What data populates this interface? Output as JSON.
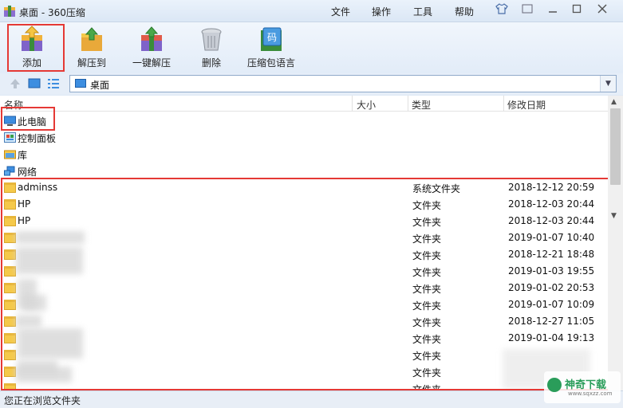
{
  "window": {
    "title": "桌面 - 360压缩"
  },
  "menu": [
    "文件",
    "操作",
    "工具",
    "帮助"
  ],
  "toolbar": {
    "buttons": [
      {
        "label": "添加",
        "icon": "add-archive-icon"
      },
      {
        "label": "解压到",
        "icon": "extract-to-icon"
      },
      {
        "label": "一键解压",
        "icon": "one-click-extract-icon"
      },
      {
        "label": "删除",
        "icon": "trash-icon"
      },
      {
        "label": "压缩包语言",
        "icon": "archive-language-icon",
        "badge": "码"
      }
    ]
  },
  "address": {
    "path": "桌面"
  },
  "columns": {
    "name": "名称",
    "size": "大小",
    "type": "类型",
    "modified": "修改日期"
  },
  "special_items": [
    {
      "name": "此电脑",
      "icon": "computer-icon"
    },
    {
      "name": "控制面板",
      "icon": "control-panel-icon"
    },
    {
      "name": "库",
      "icon": "library-icon"
    },
    {
      "name": "网络",
      "icon": "network-icon"
    }
  ],
  "files": [
    {
      "name": "adminss",
      "type": "系统文件夹",
      "date": "2018-12-12 20:59"
    },
    {
      "name": "HP",
      "type": "文件夹",
      "date": "2018-12-03 20:44"
    },
    {
      "name": "HP",
      "type": "文件夹",
      "date": "2018-12-03 20:44"
    },
    {
      "name": "",
      "type": "文件夹",
      "date": "2019-01-07 10:40"
    },
    {
      "name": "",
      "type": "文件夹",
      "date": "2018-12-21 18:48"
    },
    {
      "name": "",
      "type": "文件夹",
      "date": "2019-01-03 19:55"
    },
    {
      "name": "",
      "type": "文件夹",
      "date": "2019-01-02 20:53"
    },
    {
      "name": "",
      "type": "文件夹",
      "date": "2019-01-07 10:09"
    },
    {
      "name": "",
      "type": "文件夹",
      "date": "2018-12-27 11:05"
    },
    {
      "name": "",
      "type": "文件夹",
      "date": "2019-01-04 19:13"
    },
    {
      "name": "",
      "type": "文件夹",
      "date": ""
    },
    {
      "name": "",
      "type": "文件夹",
      "date": ""
    },
    {
      "name": "",
      "type": "文件夹",
      "date": ""
    }
  ],
  "status": {
    "text": "您正在浏览文件夹"
  },
  "watermark": {
    "text": "神奇下载",
    "sub": "www.sqxzz.com"
  },
  "colors": {
    "highlight": "#e53935",
    "folder": "#f5c94a",
    "accent": "#3d8ee0"
  }
}
